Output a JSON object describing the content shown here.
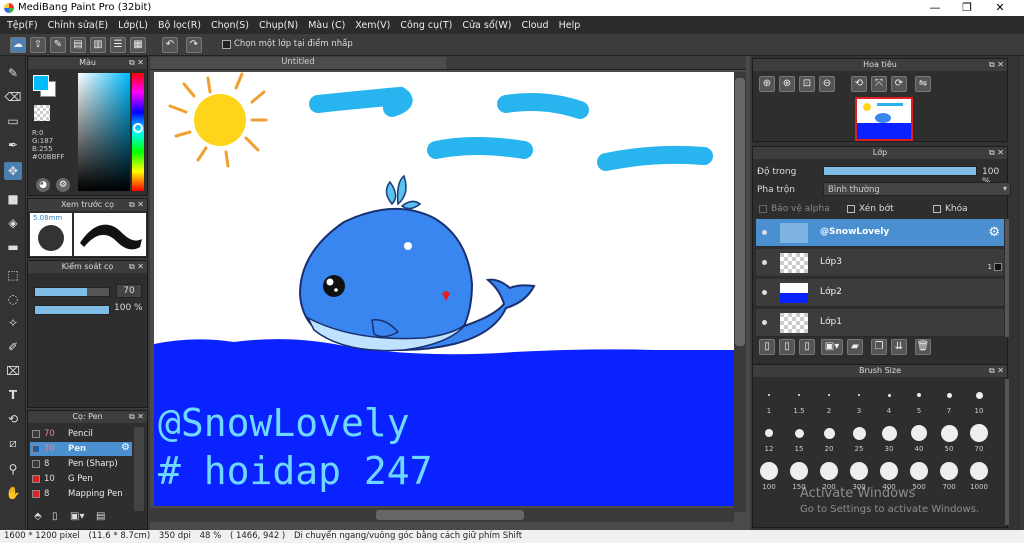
{
  "app": {
    "title": "MediBang Paint Pro (32bit)",
    "min": "—",
    "max": "❐",
    "close": "✕"
  },
  "menu": [
    "Tệp(F)",
    "Chỉnh sửa(E)",
    "Lớp(L)",
    "Bộ lọc(R)",
    "Chọn(S)",
    "Chụp(N)",
    "Màu (C)",
    "Xem(V)",
    "Công cụ(T)",
    "Cửa sổ(W)",
    "Cloud",
    "Help"
  ],
  "toolbar": {
    "checkbox_label": "Chọn một lớp tại điểm nhấp"
  },
  "doc": {
    "tab_title": "Untitled"
  },
  "color_panel": {
    "title": "Màu",
    "r": "R:0",
    "g": "G:187",
    "b": "B:255",
    "hex": "#00BBFF",
    "fg": "#00BBFF",
    "bg": "#FFFFFF"
  },
  "brush_preview": {
    "title": "Xem trước cọ",
    "size": "5.08mm"
  },
  "brush_control": {
    "title": "Kiểm soát cọ",
    "size_value": "70",
    "opacity_value": "100 %",
    "size_level": 0.7,
    "opacity_level": 1.0
  },
  "brush_list": {
    "title": "Cọ: Pen",
    "items": [
      {
        "size": "70",
        "name": "Pencil",
        "color": "#3a3a3a"
      },
      {
        "size": "70",
        "name": "Pen",
        "color": "#1a5fa8"
      },
      {
        "size": "8",
        "name": "Pen (Sharp)",
        "color": "#3a3a3a"
      },
      {
        "size": "10",
        "name": "G Pen",
        "color": "#e02020"
      },
      {
        "size": "8",
        "name": "Mapping Pen",
        "color": "#e02020"
      }
    ]
  },
  "canvas": {
    "line1": "@SnowLovely",
    "line2": "# hoidap 247"
  },
  "navigator": {
    "title": "Hoa tiêu"
  },
  "layer_panel": {
    "title": "Lớp",
    "opacity_label": "Độ trong",
    "opacity_value": "100 %",
    "opacity_level": 1.0,
    "blend_label": "Pha trộn",
    "blend_value": "Bình thường",
    "protect_alpha": "Bảo vệ alpha",
    "clipping": "Xén bớt",
    "lock": "Khóa",
    "layers": [
      {
        "name": "@SnowLovely",
        "selected": true
      },
      {
        "name": "Lớp3",
        "selected": false
      },
      {
        "name": "Lớp2",
        "selected": false
      },
      {
        "name": "Lớp1",
        "selected": false
      }
    ],
    "layer3_badge": "1"
  },
  "brush_size": {
    "title": "Brush Size",
    "rows": [
      [
        "1",
        "1.5",
        "2",
        "3",
        "4",
        "5",
        "7",
        "10"
      ],
      [
        "12",
        "15",
        "20",
        "25",
        "30",
        "40",
        "50",
        "70"
      ],
      [
        "100",
        "150",
        "200",
        "300",
        "400",
        "500",
        "700",
        "1000"
      ]
    ]
  },
  "watermark": {
    "line1": "Activate Windows",
    "line2": "Go to Settings to activate Windows."
  },
  "status": {
    "size": "1600 * 1200 pixel",
    "physical": "(11.6 * 8.7cm)",
    "dpi": "350 dpi",
    "zoom": "48 %",
    "coords": "( 1466, 942 )",
    "hint": "Di chuyển ngang/vuông góc bằng cách giữ phím Shift"
  }
}
